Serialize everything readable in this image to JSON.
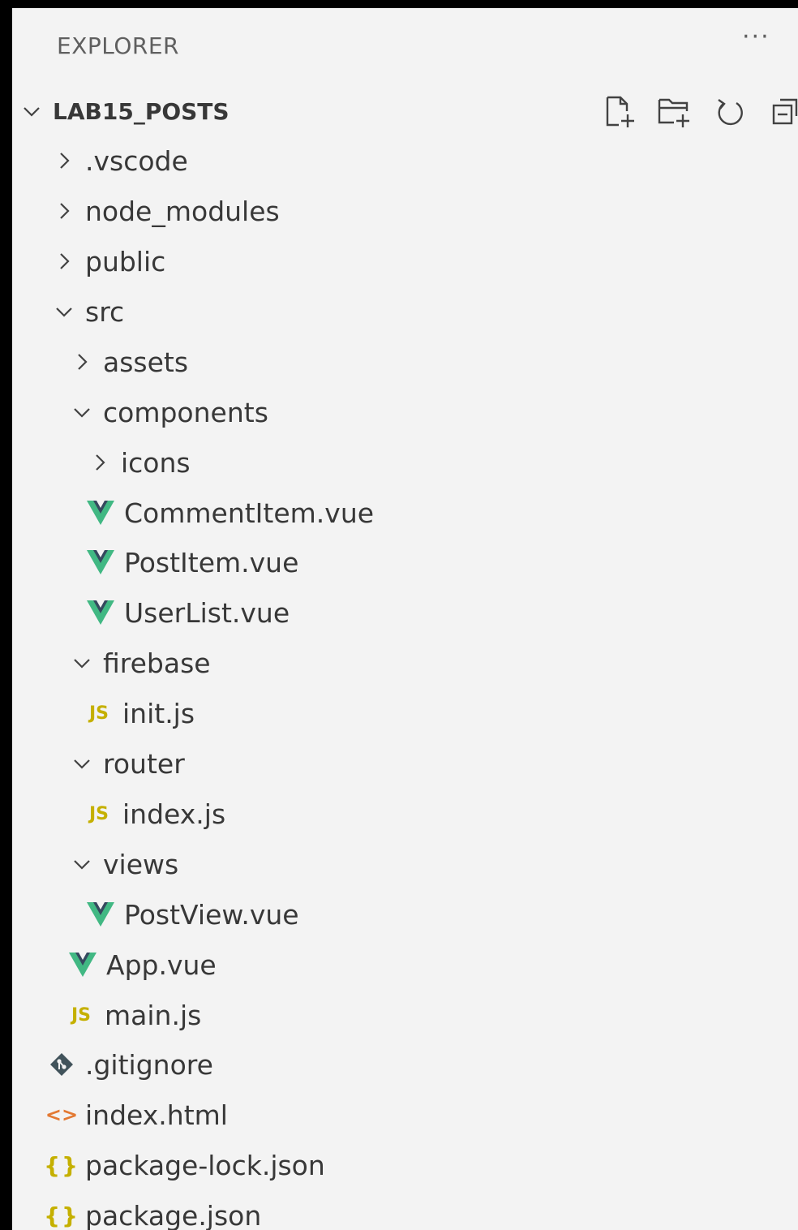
{
  "explorer": {
    "title": "EXPLORER",
    "more": "···",
    "root": "LAB15_POSTS"
  },
  "actions": [
    {
      "name": "new-file-icon"
    },
    {
      "name": "new-folder-icon"
    },
    {
      "name": "refresh-icon"
    },
    {
      "name": "collapse-all-icon"
    }
  ],
  "tree": [
    {
      "label": ".vscode",
      "kind": "folder",
      "open": false
    },
    {
      "label": "node_modules",
      "kind": "folder",
      "open": false
    },
    {
      "label": "public",
      "kind": "folder",
      "open": false
    },
    {
      "label": "src",
      "kind": "folder",
      "open": true
    },
    {
      "label": "assets",
      "kind": "folder",
      "open": false
    },
    {
      "label": "components",
      "kind": "folder",
      "open": true
    },
    {
      "label": "icons",
      "kind": "folder",
      "open": false
    },
    {
      "label": "CommentItem.vue",
      "kind": "vue"
    },
    {
      "label": "PostItem.vue",
      "kind": "vue"
    },
    {
      "label": "UserList.vue",
      "kind": "vue"
    },
    {
      "label": "firebase",
      "kind": "folder",
      "open": true
    },
    {
      "label": "init.js",
      "kind": "js",
      "icon_text": "JS"
    },
    {
      "label": "router",
      "kind": "folder",
      "open": true
    },
    {
      "label": "index.js",
      "kind": "js",
      "icon_text": "JS"
    },
    {
      "label": "views",
      "kind": "folder",
      "open": true
    },
    {
      "label": "PostView.vue",
      "kind": "vue"
    },
    {
      "label": "App.vue",
      "kind": "vue"
    },
    {
      "label": "main.js",
      "kind": "js",
      "icon_text": "JS"
    },
    {
      "label": ".gitignore",
      "kind": "git"
    },
    {
      "label": "index.html",
      "kind": "html",
      "icon_text": "<>"
    },
    {
      "label": "package-lock.json",
      "kind": "json",
      "icon_text": "{}"
    },
    {
      "label": "package.json",
      "kind": "json",
      "icon_text": "{}"
    }
  ],
  "colors": {
    "background": "#f3f3f3",
    "text": "#383838",
    "vue_green": "#41b883",
    "vue_dark": "#35495e",
    "js_yellow": "#c5b000",
    "html_orange": "#e37933",
    "git_dark": "#41535b"
  }
}
